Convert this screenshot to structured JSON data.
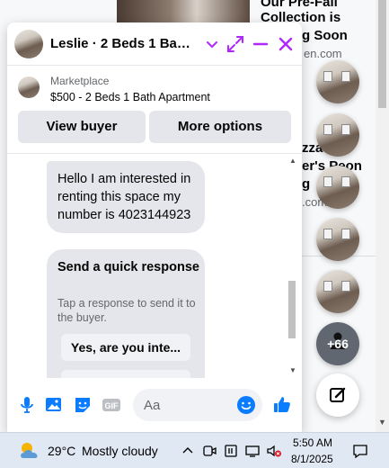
{
  "background": {
    "heading_lines": [
      "Our Pre-Fall",
      "Collection is",
      "g Soon"
    ],
    "heading_sub": "en.com",
    "partial_lines": [
      "zza",
      "er's Peon",
      "g"
    ],
    "partial_sub": ".com"
  },
  "chat": {
    "title": "Leslie · 2 Beds 1 Bath ...",
    "marketplace_label": "Marketplace",
    "listing": "$500 - 2 Beds 1 Bath Apartment",
    "view_buyer": "View buyer",
    "more_options": "More options",
    "message": "Hello I am interested in renting this space my number is 4023144923",
    "quick_title": "Send a quick response",
    "quick_sub": "Tap a response to send it to the buyer.",
    "quick_reply_1": "Yes, are you inte...",
    "quick_reply_2": "",
    "input_placeholder": "Aa"
  },
  "chatheads": {
    "more_count": "+66"
  },
  "taskbar": {
    "temperature": "29°C",
    "condition": "Mostly cloudy",
    "time": "5:50 AM",
    "date": "8/1/2025"
  },
  "colors": {
    "messenger_purple": "#b026ff",
    "messenger_blue": "#0a7cff",
    "bubble_gray": "#e4e6eb",
    "taskbar": "#dfe8f3"
  },
  "icons": [
    "chevron-down-icon",
    "expand-icon",
    "minimize-icon",
    "close-icon",
    "microphone-icon",
    "photo-icon",
    "sticker-icon",
    "gif-icon",
    "emoji-icon",
    "like-icon",
    "compose-icon",
    "weather-icon",
    "chevron-up-icon",
    "battery-icon",
    "network-icon",
    "volume-muted-icon",
    "notification-icon"
  ]
}
